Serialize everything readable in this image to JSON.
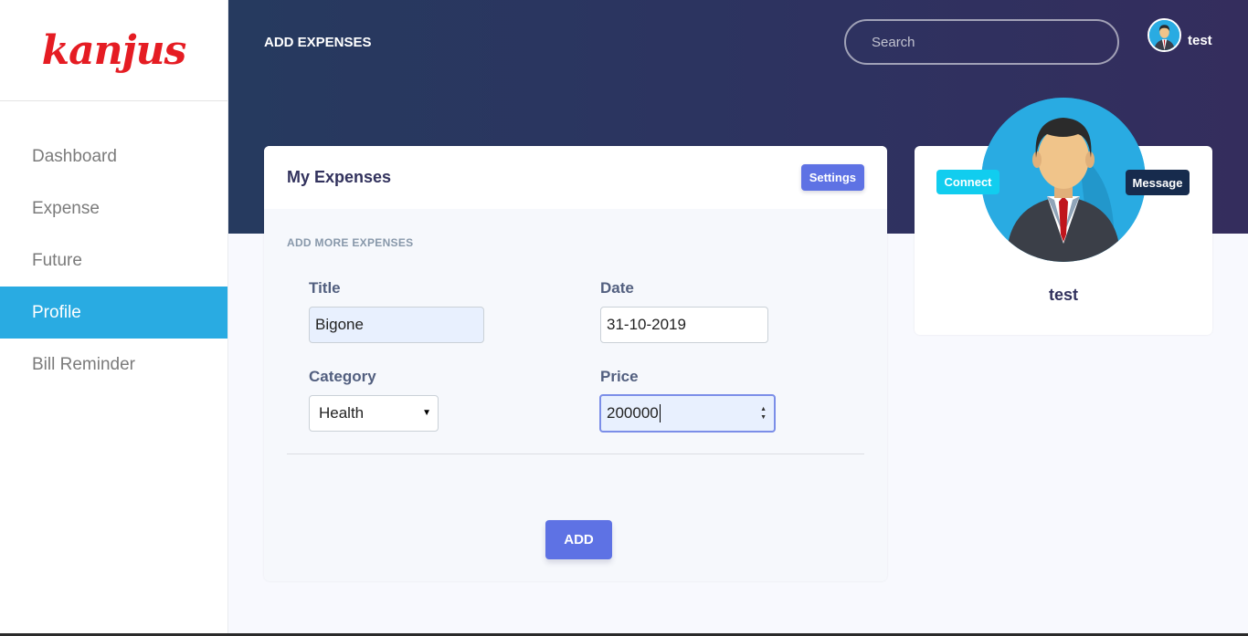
{
  "brand": {
    "logo_text": "kanjus",
    "color": "#e51c23"
  },
  "sidebar": {
    "items": [
      {
        "label": "Dashboard"
      },
      {
        "label": "Expense"
      },
      {
        "label": "Future"
      },
      {
        "label": "Profile",
        "active": true
      },
      {
        "label": "Bill Reminder"
      }
    ]
  },
  "header": {
    "title": "ADD EXPENSES",
    "search": {
      "placeholder": "Search",
      "value": ""
    },
    "user": {
      "name": "test"
    }
  },
  "expenses_card": {
    "title": "My Expenses",
    "settings_label": "Settings",
    "section_label": "ADD MORE EXPENSES",
    "form": {
      "title": {
        "label": "Title",
        "value": "Bigone"
      },
      "date": {
        "label": "Date",
        "value": "31-10-2019"
      },
      "category": {
        "label": "Category",
        "value": "Health"
      },
      "price": {
        "label": "Price",
        "value": "200000"
      }
    },
    "add_label": "ADD"
  },
  "profile_card": {
    "connect_label": "Connect",
    "message_label": "Message",
    "name": "test"
  },
  "colors": {
    "accent": "#5e72e4",
    "active_nav": "#29abe2",
    "connect": "#11cdef",
    "message": "#172b4d",
    "header_bg": "#2e3260"
  }
}
